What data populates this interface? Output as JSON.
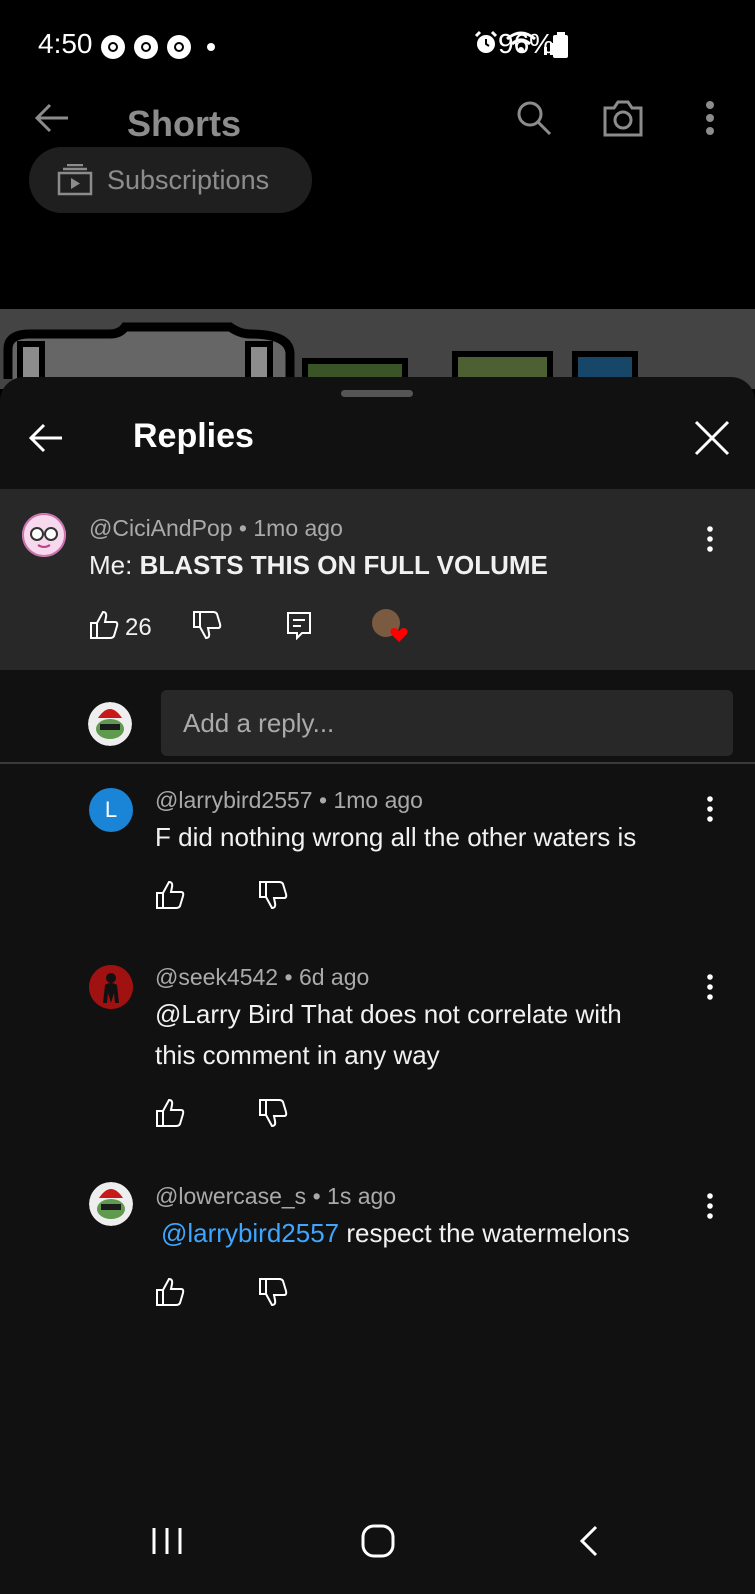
{
  "status_bar": {
    "time": "4:50",
    "battery": "96%",
    "icons": [
      "chrome-icon",
      "chrome-icon",
      "chrome-icon",
      "alarm-icon",
      "wifi-icon",
      "signal-icon",
      "battery-icon"
    ]
  },
  "app_header": {
    "title": "Shorts",
    "chip_label": "Subscriptions"
  },
  "sheet": {
    "title": "Replies"
  },
  "parent_comment": {
    "author": "@CiciAndPop",
    "time": "1mo ago",
    "text_prefix": "Me: ",
    "text_bold": "BLASTS THIS ON FULL VOLUME",
    "likes": "26",
    "avatar_color": "#f4c7e8"
  },
  "reply_box": {
    "placeholder": "Add a reply..."
  },
  "replies": [
    {
      "author": "@larrybird2557",
      "time": "1mo ago",
      "avatar_letter": "L",
      "avatar_color": "#1a85d6",
      "text": "F did nothing wrong all the other waters is"
    },
    {
      "author": "@seek4542",
      "time": "6d ago",
      "avatar_color": "#b01010",
      "text_line1": "@Larry Bird  That does not correlate with",
      "text_line2": "this comment in any way"
    },
    {
      "author": "@lowercase_s",
      "time": "1s ago",
      "mention": "@larrybird2557",
      "text": " respect the watermelons"
    }
  ],
  "colors": {
    "background": "#000000",
    "sheet": "#111111",
    "parent_bg": "#282828",
    "mention": "#3ea6ff",
    "meta": "#aaaaaa"
  }
}
